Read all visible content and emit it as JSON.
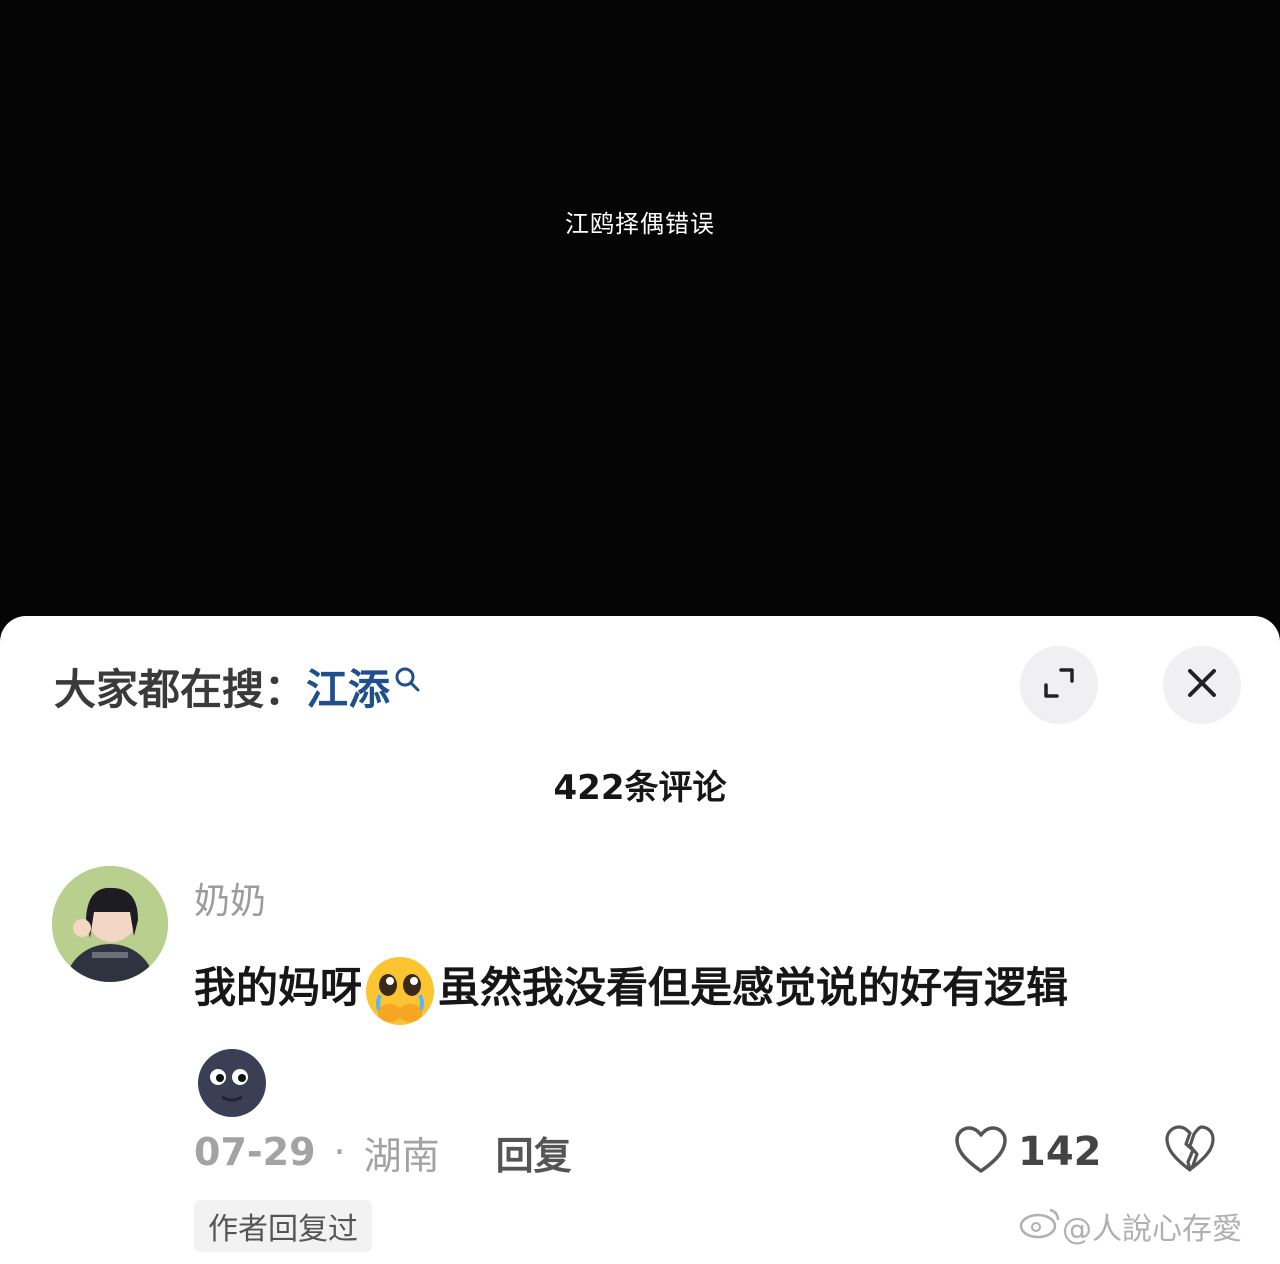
{
  "video": {
    "caption": "江鸥择偶错误"
  },
  "search": {
    "prefix": "大家都在搜：",
    "term": "江添"
  },
  "header": {
    "comment_count": "422条评论"
  },
  "comment": {
    "username": "奶奶",
    "text_part1": "我的妈呀",
    "text_part2": "虽然我没看但是感觉说的好有逻辑",
    "date": "07-29",
    "dot": "·",
    "location": "湖南",
    "reply_label": "回复",
    "like_count": "142",
    "author_tag": "作者回复过"
  },
  "watermark": {
    "text": "@人說心存愛"
  },
  "icons": {
    "expand": "expand-icon",
    "close": "close-icon",
    "like": "heart-outline-icon",
    "dislike": "broken-heart-icon",
    "emoji1": "pleading-face-emoji",
    "emoji2": "new-moon-face-emoji"
  },
  "colors": {
    "search_term": "#1f4f8c",
    "background_dark": "#050505"
  }
}
